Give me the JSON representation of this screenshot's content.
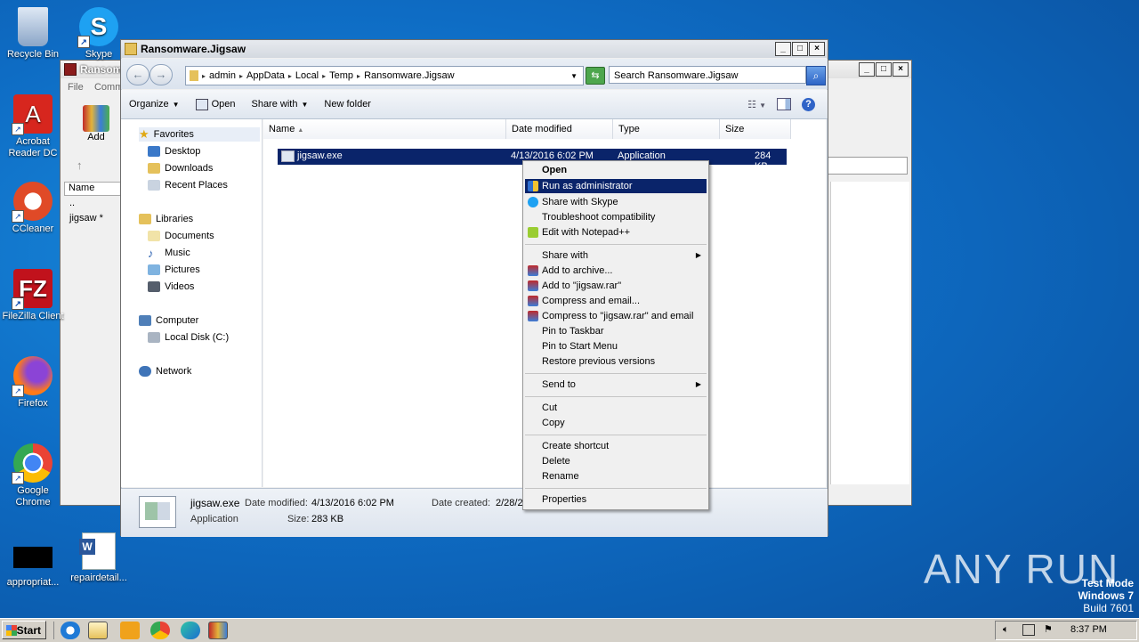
{
  "desktop": {
    "icons": [
      {
        "label": "Recycle Bin",
        "icon": "recycle-bin-icon",
        "color": "#9db7d6"
      },
      {
        "label": "Skype",
        "icon": "skype-icon",
        "color": "#1ea1f2"
      },
      {
        "label": "Acrobat Reader DC",
        "icon": "acrobat-icon",
        "color": "#d7261e"
      },
      {
        "label": "CCleaner",
        "icon": "ccleaner-icon",
        "color": "#e04a27"
      },
      {
        "label": "FileZilla Client",
        "icon": "filezilla-icon",
        "color": "#c1121c"
      },
      {
        "label": "Firefox",
        "icon": "firefox-icon",
        "color": "#ff7a18"
      },
      {
        "label": "Google Chrome",
        "icon": "chrome-icon",
        "color": "#34a853"
      },
      {
        "label": "appropriat...",
        "icon": "blank-file-icon",
        "color": "#000000"
      },
      {
        "label": "repairdetail...",
        "icon": "word-doc-icon",
        "color": "#2b579a"
      }
    ]
  },
  "rar_window": {
    "title": "Ransom",
    "menu": [
      "File",
      "Comm"
    ],
    "add_label": "Add",
    "col_name": "Name",
    "rows": [
      "..",
      "jigsaw *"
    ]
  },
  "explorer": {
    "title": "Ransomware.Jigsaw",
    "breadcrumb": [
      "admin",
      "AppData",
      "Local",
      "Temp",
      "Ransomware.Jigsaw"
    ],
    "search_placeholder": "Search Ransomware.Jigsaw",
    "toolbar": {
      "organize": "Organize",
      "open": "Open",
      "share_with": "Share with",
      "new_folder": "New folder"
    },
    "nav": {
      "favorites": "Favorites",
      "desktop": "Desktop",
      "downloads": "Downloads",
      "recent": "Recent Places",
      "libraries": "Libraries",
      "documents": "Documents",
      "music": "Music",
      "pictures": "Pictures",
      "videos": "Videos",
      "computer": "Computer",
      "local_disk": "Local Disk (C:)",
      "network": "Network"
    },
    "columns": {
      "name": "Name",
      "date": "Date modified",
      "type": "Type",
      "size": "Size"
    },
    "file": {
      "name": "jigsaw.exe",
      "date": "4/13/2016 6:02 PM",
      "type": "Application",
      "size": "284 KB"
    },
    "details": {
      "filename": "jigsaw.exe",
      "modified_label": "Date modified:",
      "modified": "4/13/2016 6:02 PM",
      "created_label": "Date created:",
      "created": "2/28/2",
      "type": "Application",
      "size_label": "Size:",
      "size": "283 KB"
    }
  },
  "context_menu": {
    "open": "Open",
    "run_admin": "Run as administrator",
    "share_skype": "Share with Skype",
    "troubleshoot": "Troubleshoot compatibility",
    "notepad": "Edit with Notepad++",
    "share_with": "Share with",
    "add_archive": "Add to archive...",
    "add_rar": "Add to \"jigsaw.rar\"",
    "compress_email": "Compress and email...",
    "compress_rar_email": "Compress to \"jigsaw.rar\" and email",
    "pin_taskbar": "Pin to Taskbar",
    "pin_start": "Pin to Start Menu",
    "restore": "Restore previous versions",
    "send_to": "Send to",
    "cut": "Cut",
    "copy": "Copy",
    "create_shortcut": "Create shortcut",
    "delete": "Delete",
    "rename": "Rename",
    "properties": "Properties"
  },
  "taskbar": {
    "start": "Start",
    "time": "8:37 PM"
  },
  "watermark": "ANY RUN",
  "testmode": {
    "line1": "Test Mode",
    "line2": "Windows 7",
    "line3": "Build 7601"
  }
}
